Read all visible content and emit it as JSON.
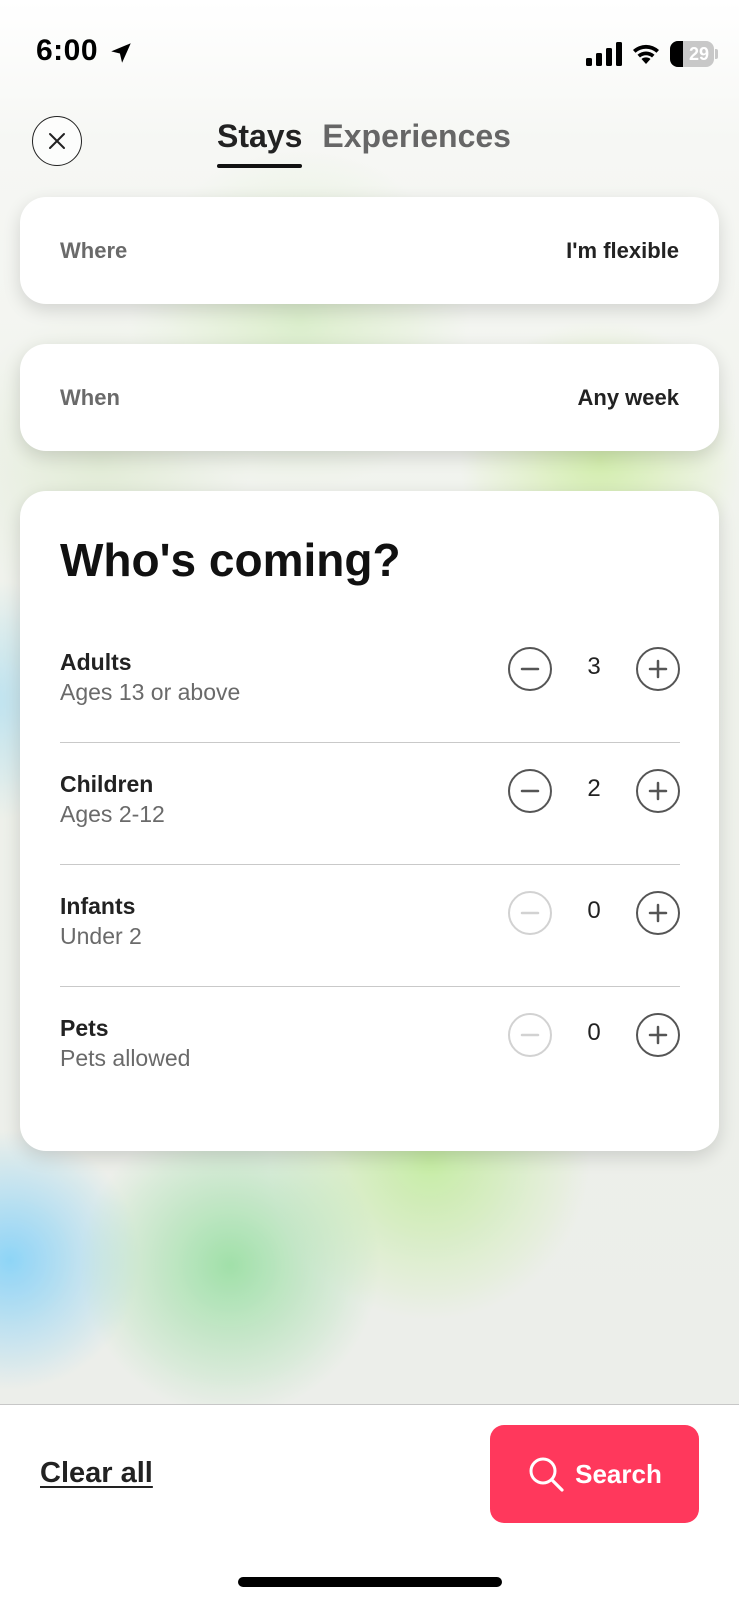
{
  "status_bar": {
    "time": "6:00",
    "battery_percent": "29",
    "battery_level": 0.29
  },
  "header": {
    "tabs": [
      {
        "label": "Stays",
        "active": true
      },
      {
        "label": "Experiences",
        "active": false
      }
    ]
  },
  "where": {
    "label": "Where",
    "value": "I'm flexible"
  },
  "when": {
    "label": "When",
    "value": "Any week"
  },
  "guests": {
    "title": "Who's coming?",
    "rows": [
      {
        "name": "Adults",
        "desc": "Ages 13 or above",
        "count": "3",
        "minus_enabled": true
      },
      {
        "name": "Children",
        "desc": "Ages 2-12",
        "count": "2",
        "minus_enabled": true
      },
      {
        "name": "Infants",
        "desc": "Under 2",
        "count": "0",
        "minus_enabled": false
      },
      {
        "name": "Pets",
        "desc": "Pets allowed",
        "count": "0",
        "minus_enabled": false
      }
    ]
  },
  "footer": {
    "clear_label": "Clear all",
    "search_label": "Search"
  },
  "colors": {
    "accent": "#ff385c",
    "text": "#222222",
    "muted": "#6a6a6a"
  },
  "icons": {
    "close": "close-icon",
    "search": "search-icon",
    "minus": "minus-icon",
    "plus": "plus-icon"
  }
}
